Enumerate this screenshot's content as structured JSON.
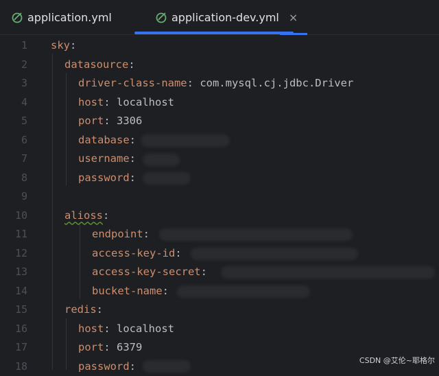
{
  "tabs": [
    {
      "label": "application.yml",
      "active": false
    },
    {
      "label": "application-dev.yml",
      "active": true,
      "close": "×"
    }
  ],
  "code": {
    "lines": [
      {
        "no": "1",
        "key": "sky",
        "sep": ":",
        "value": ""
      },
      {
        "no": "2",
        "key": "datasource",
        "sep": ":",
        "value": ""
      },
      {
        "no": "3",
        "key": "driver-class-name",
        "sep": ":",
        "value": " com.mysql.cj.jdbc.Driver"
      },
      {
        "no": "4",
        "key": "host",
        "sep": ":",
        "value": " localhost"
      },
      {
        "no": "5",
        "key": "port",
        "sep": ":",
        "value": " 3306"
      },
      {
        "no": "6",
        "key": "database",
        "sep": ":",
        "value": ""
      },
      {
        "no": "7",
        "key": "username",
        "sep": ":",
        "value": ""
      },
      {
        "no": "8",
        "key": "password",
        "sep": ":",
        "value": ""
      },
      {
        "no": "9",
        "key": "",
        "sep": "",
        "value": ""
      },
      {
        "no": "10",
        "key": "alioss",
        "sep": ":",
        "value": ""
      },
      {
        "no": "11",
        "key": "endpoint",
        "sep": ":",
        "value": ""
      },
      {
        "no": "12",
        "key": "access-key-id",
        "sep": ":",
        "value": ""
      },
      {
        "no": "13",
        "key": "access-key-secret",
        "sep": ":",
        "value": ""
      },
      {
        "no": "14",
        "key": "bucket-name",
        "sep": ":",
        "value": ""
      },
      {
        "no": "15",
        "key": "redis",
        "sep": ":",
        "value": ""
      },
      {
        "no": "16",
        "key": "host",
        "sep": ":",
        "value": " localhost"
      },
      {
        "no": "17",
        "key": "port",
        "sep": ":",
        "value": " 6379"
      },
      {
        "no": "18",
        "key": "password",
        "sep": ":",
        "value": ""
      }
    ]
  },
  "watermark": "CSDN @艾伦~耶格尔",
  "colors": {
    "background": "#1e1f22",
    "key": "#cf8e6d",
    "value": "#bcbec4",
    "line_number": "#4b5059",
    "tab_active_underline": "#3574f0"
  }
}
